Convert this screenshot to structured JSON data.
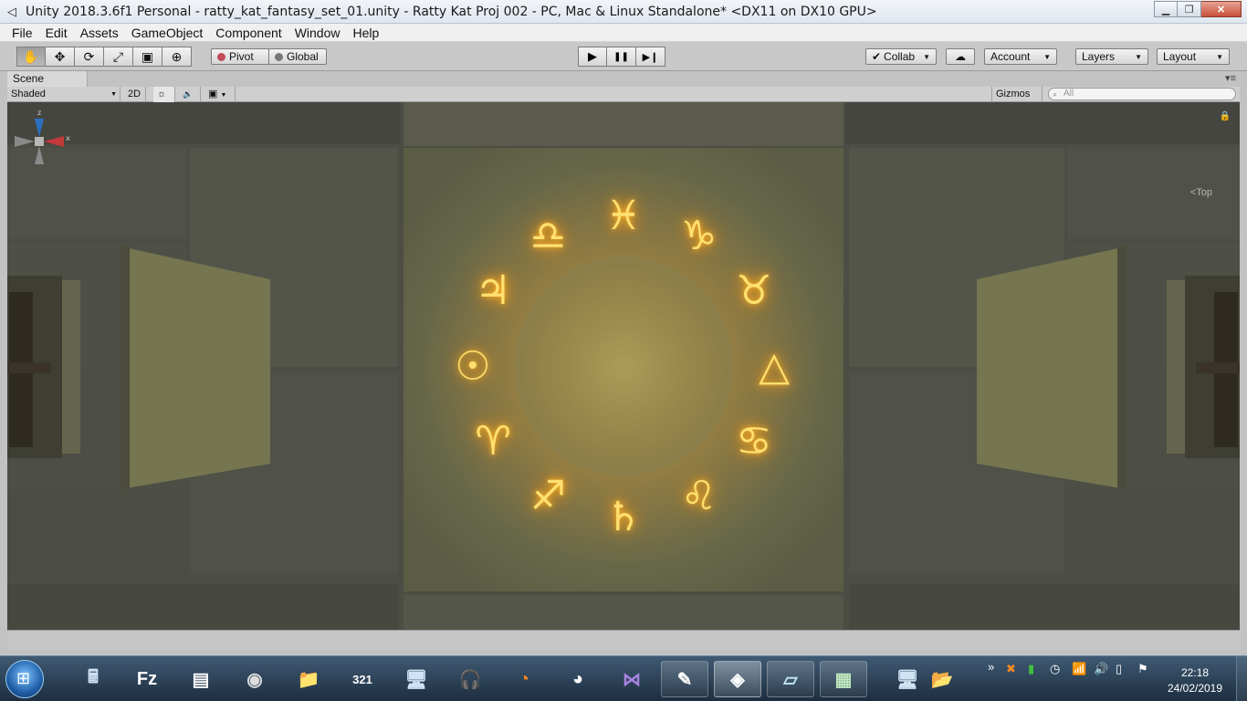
{
  "window": {
    "title": "Unity 2018.3.6f1 Personal - ratty_kat_fantasy_set_01.unity - Ratty Kat Proj 002 - PC, Mac & Linux Standalone* <DX11 on DX10 GPU>",
    "minimize": "▁",
    "restore": "❐",
    "close": "✕"
  },
  "menu": [
    "File",
    "Edit",
    "Assets",
    "GameObject",
    "Component",
    "Window",
    "Help"
  ],
  "toolbar": {
    "tools": [
      {
        "name": "hand-tool",
        "icon": "✋"
      },
      {
        "name": "move-tool",
        "icon": "✥"
      },
      {
        "name": "rotate-tool",
        "icon": "⟳"
      },
      {
        "name": "scale-tool",
        "icon": "⤢"
      },
      {
        "name": "rect-tool",
        "icon": "▣"
      },
      {
        "name": "transform-tool",
        "icon": "⊕"
      }
    ],
    "pivot": "Pivot",
    "global": "Global",
    "play": "▶",
    "pause": "❚❚",
    "step": "▶❙",
    "collab": "Collab",
    "cloud": "☁",
    "account": "Account",
    "layers": "Layers",
    "layout": "Layout"
  },
  "scene": {
    "tab": "Scene",
    "shading": "Shaded",
    "mode_2d": "2D",
    "light": "☼",
    "audio": "🔈",
    "effects": "▣",
    "gizmos": "Gizmos",
    "search_placeholder": "All",
    "view_label": "<Top",
    "axis_x": "x",
    "axis_z": "z"
  },
  "runes": [
    "♓",
    "♑",
    "♉",
    "△",
    "♋",
    "♌",
    "♄",
    "♐",
    "♈",
    "☉",
    "♃",
    "♎"
  ],
  "colors": {
    "rune_glow": "#ffb020",
    "rune_core": "#ffe070",
    "stone_dark": "#4a4b42",
    "floor_center": "#7b7c52"
  },
  "taskbar": {
    "start": "⊞",
    "apps": [
      {
        "name": "calculator",
        "icon": "🖩"
      },
      {
        "name": "filezilla",
        "icon": "Fz"
      },
      {
        "name": "android-app",
        "icon": "▤"
      },
      {
        "name": "media-app",
        "icon": "◉"
      },
      {
        "name": "file-explorer",
        "icon": "📁"
      },
      {
        "name": "video-editor",
        "icon": "321"
      },
      {
        "name": "remote-desktop",
        "icon": "🖥"
      },
      {
        "name": "audio-app",
        "icon": "🎧"
      },
      {
        "name": "blender",
        "icon": "◔"
      },
      {
        "name": "chrome",
        "icon": "◕"
      },
      {
        "name": "visual-studio",
        "icon": "⋈"
      },
      {
        "name": "paint-app",
        "icon": "✎"
      },
      {
        "name": "unity",
        "icon": "◈"
      },
      {
        "name": "notes-app",
        "icon": "▱"
      },
      {
        "name": "terminal-app",
        "icon": "▦"
      },
      {
        "name": "computer",
        "icon": "🖥"
      },
      {
        "name": "folder",
        "icon": "📂"
      }
    ],
    "tray_expand": "»",
    "time": "22:18",
    "date": "24/02/2019"
  }
}
